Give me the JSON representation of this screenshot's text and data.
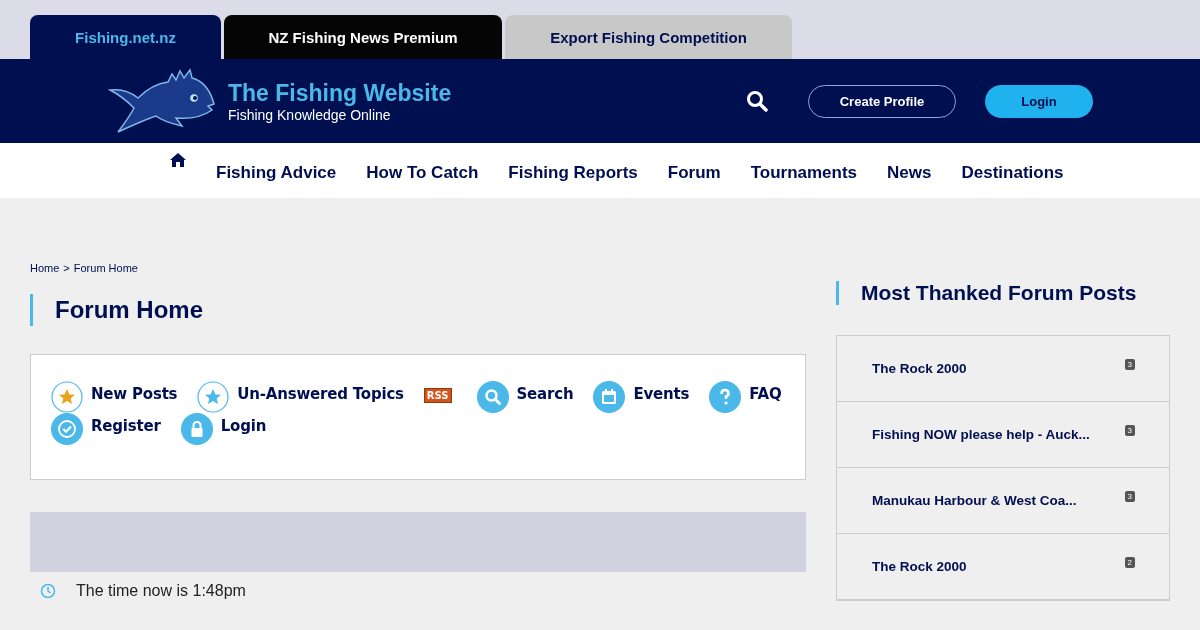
{
  "site_tabs": [
    {
      "label": "Fishing.net.nz",
      "selected": true,
      "color": "#000f50"
    },
    {
      "label": "NZ Fishing News Premium",
      "selected": false,
      "color": "#050505"
    },
    {
      "label": "Export Fishing Competition",
      "selected": false,
      "color": "#c8c8c8"
    }
  ],
  "header": {
    "title": "The Fishing Website",
    "tagline": "Fishing Knowledge Online",
    "buttons": [
      {
        "label": "Create Profile",
        "kind": "outline"
      },
      {
        "label": "Login",
        "kind": "filled"
      }
    ]
  },
  "nav": [
    "Fishing Advice",
    "How To Catch",
    "Fishing Reports",
    "Forum",
    "Tournaments",
    "News",
    "Destinations"
  ],
  "breadcrumb": {
    "items": [
      "Home",
      "Forum Home"
    ],
    "separator": ">"
  },
  "page_title": "Forum Home",
  "toolbar": [
    {
      "kind": "newposts",
      "label": "New Posts"
    },
    {
      "kind": "unanswered",
      "label": "Un-Answered Topics"
    },
    {
      "kind": "rss",
      "label": "RSS"
    },
    {
      "kind": "search",
      "label": "Search"
    },
    {
      "kind": "events",
      "label": "Events"
    },
    {
      "kind": "faq",
      "label": "FAQ"
    },
    {
      "kind": "register",
      "label": "Register"
    },
    {
      "kind": "login",
      "label": "Login"
    }
  ],
  "time_text": "The time now is 1:48pm",
  "sidebar": {
    "title": "Most Thanked Forum Posts",
    "posts": [
      {
        "title": "The Rock 2000",
        "count": "3"
      },
      {
        "title": "Fishing NOW please help - Auck...",
        "count": "3"
      },
      {
        "title": "Manukau Harbour & West Coa...",
        "count": "3"
      },
      {
        "title": "The Rock 2000",
        "count": "2"
      }
    ]
  }
}
